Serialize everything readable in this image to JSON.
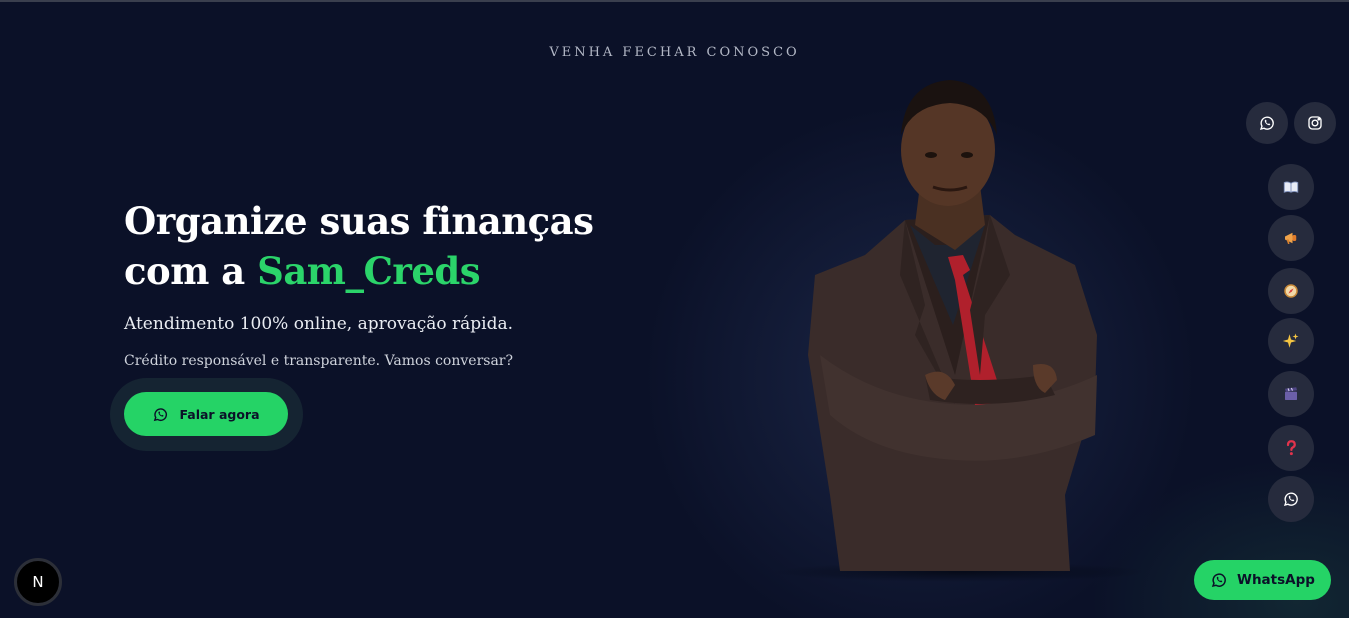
{
  "eyebrow": "VENHA FECHAR CONOSCO",
  "hero": {
    "headline_line1": "Organize suas finanças",
    "headline_line2_prefix": "com a ",
    "brand": "Sam_Creds",
    "lead": "Atendimento 100% online, aprovação rápida.",
    "sub": "Crédito responsável e transparente. Vamos conversar?",
    "cta_label": "Falar agora"
  },
  "social": [
    {
      "name": "whatsapp",
      "icon": "whatsapp-icon"
    },
    {
      "name": "instagram",
      "icon": "instagram-icon"
    }
  ],
  "rail": [
    {
      "icon": "book-icon"
    },
    {
      "icon": "megaphone-icon"
    },
    {
      "icon": "compass-icon"
    },
    {
      "icon": "sparkles-icon"
    },
    {
      "icon": "clapper-icon"
    },
    {
      "icon": "question-icon"
    },
    {
      "icon": "whatsapp-icon"
    }
  ],
  "float_whatsapp": {
    "label": "WhatsApp",
    "icon": "whatsapp-icon"
  },
  "dev_badge": {
    "label": "N"
  },
  "colors": {
    "background": "#0b1128",
    "brand_green": "#25d366",
    "text_green": "#2bd46a",
    "chip": "#262b3d"
  }
}
